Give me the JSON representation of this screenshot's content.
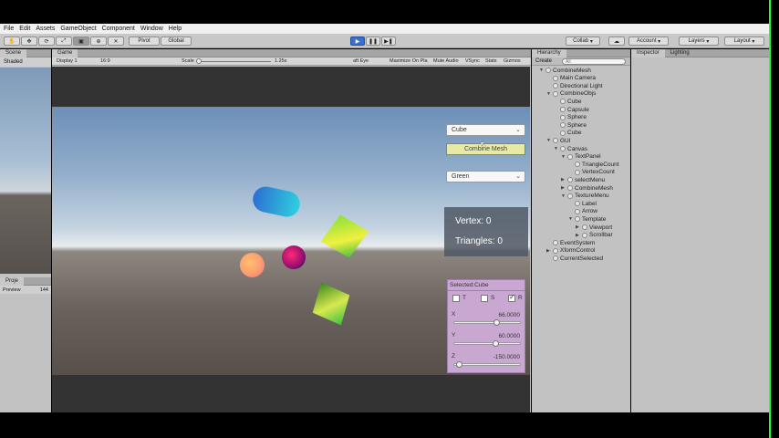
{
  "menu": [
    "File",
    "Edit",
    "Assets",
    "GameObject",
    "Component",
    "Window",
    "Help"
  ],
  "toolbar": {
    "pivot": "Pivot",
    "global": "Global",
    "collab": "Collab",
    "account": "Account",
    "layers": "Layers",
    "layout": "Layout"
  },
  "scene_panel": {
    "tab": "Scene",
    "shading": "Shaded"
  },
  "project_panel": {
    "tab": "Proje",
    "preview": "Preview",
    "count": "144"
  },
  "game_panel": {
    "tab": "Game",
    "display": "Display 1",
    "aspect": "16:9",
    "scale_label": "Scale",
    "scale_value": "1.25x",
    "options": [
      "aft Eye",
      "Maximize On Pla",
      "Mute Audio",
      "VSync",
      "Stats",
      "Gizmos"
    ]
  },
  "game_ui": {
    "shape_dropdown": "Cube",
    "combine_button": "Combine Mesh",
    "color_dropdown": "Green",
    "vertex_text": "Vertex: 0",
    "triangles_text": "Triangles: 0",
    "selected_title": "Selected:Cube",
    "toggles": [
      "T",
      "S",
      "R"
    ],
    "x_label": "X",
    "x_value": "66.0000",
    "y_label": "Y",
    "y_value": "60.0000",
    "z_label": "Z",
    "z_value": "-150.0000"
  },
  "hierarchy": {
    "tab": "Hierarchy",
    "create": "Create",
    "search_placeholder": "All",
    "items": [
      {
        "label": "CombineMesh",
        "indent": 0,
        "expanded": true
      },
      {
        "label": "Main Camera",
        "indent": 1
      },
      {
        "label": "Directional Light",
        "indent": 1
      },
      {
        "label": "CombineObjs",
        "indent": 1,
        "expanded": true
      },
      {
        "label": "Cube",
        "indent": 2
      },
      {
        "label": "Capsule",
        "indent": 2
      },
      {
        "label": "Sphere",
        "indent": 2
      },
      {
        "label": "Sphere",
        "indent": 2
      },
      {
        "label": "Cube",
        "indent": 2
      },
      {
        "label": "GUI",
        "indent": 1,
        "expanded": true
      },
      {
        "label": "Canvas",
        "indent": 2,
        "expanded": true
      },
      {
        "label": "TextPanel",
        "indent": 3,
        "expanded": true
      },
      {
        "label": "TriangleCount",
        "indent": 4
      },
      {
        "label": "VertexCount",
        "indent": 4
      },
      {
        "label": "selectMenu",
        "indent": 3,
        "collapsed": true
      },
      {
        "label": "CombineMesh",
        "indent": 3,
        "collapsed": true
      },
      {
        "label": "TextureMenu",
        "indent": 3,
        "expanded": true
      },
      {
        "label": "Label",
        "indent": 4
      },
      {
        "label": "Arrow",
        "indent": 4
      },
      {
        "label": "Template",
        "indent": 4,
        "expanded": true
      },
      {
        "label": "Viewport",
        "indent": 5,
        "collapsed": true
      },
      {
        "label": "Scrollbar",
        "indent": 5,
        "collapsed": true
      },
      {
        "label": "EventSystem",
        "indent": 1
      },
      {
        "label": "XformControl",
        "indent": 1,
        "collapsed": true
      },
      {
        "label": "CurrentSelected",
        "indent": 1
      }
    ]
  },
  "inspector": {
    "tab": "Inspector",
    "lighting_tab": "Lighting"
  },
  "colors": {
    "play_blue": "#3b6fcf",
    "panel_gray": "#c2c2c2",
    "combine_button": "#e8e9a4",
    "selected_panel": "#c8a8d0"
  }
}
